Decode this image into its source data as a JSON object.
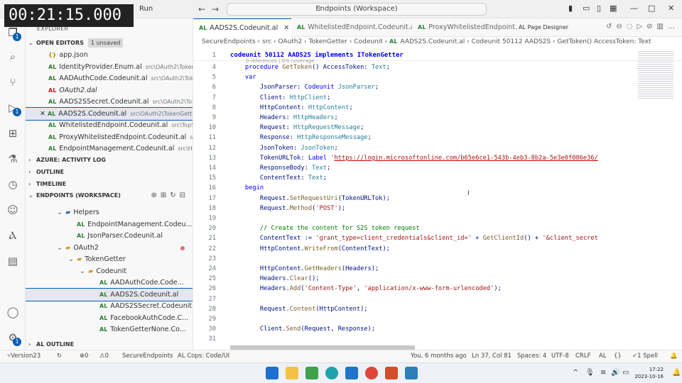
{
  "timer": "00:21:15.000",
  "menu": {
    "run": "Run"
  },
  "command_center": {
    "text": "Endpoints (Workspace)"
  },
  "explorer": {
    "title": "EXPLORER",
    "open_editors_label": "OPEN EDITORS",
    "unsaved_badge": "1 unsaved",
    "open_editors": [
      {
        "icon": "json",
        "name": "app.json",
        "path": "",
        "style": "normal"
      },
      {
        "icon": "AL",
        "name": "IdentityProvider.Enum.al",
        "path": "src\\OAuth2\\Token...",
        "style": "normal"
      },
      {
        "icon": "AL",
        "name": "AADAuthCode.Codeunit.al",
        "path": "src\\OAuth2\\Tok...",
        "style": "normal"
      },
      {
        "icon": "AL",
        "name": "OAuth2.dal",
        "path": "",
        "style": "italic"
      },
      {
        "icon": "AL",
        "name": "AADS2SSecret.Codeunit.al",
        "path": "src\\OAuth2\\Tok...",
        "style": "normal"
      },
      {
        "icon": "AL",
        "name": "AADS2S.Codeunit.al",
        "path": "src\\OAuth2\\TokenGett...",
        "style": "selected"
      },
      {
        "icon": "AL",
        "name": "WhitelistedEndpoint.Codeunit.al",
        "path": "src\\TopSe...",
        "style": "normal"
      },
      {
        "icon": "AL",
        "name": "ProxyWhitelistedEndpoint.Codeunit.al",
        "path": "src\\...",
        "style": "normal"
      },
      {
        "icon": "AL",
        "name": "EndpointManagement.Codeunit.al",
        "path": "src\\Hel...",
        "style": "normal"
      }
    ],
    "azure_label": "AZURE: ACTIVITY LOG",
    "outline_label": "OUTLINE",
    "timeline_label": "TIMELINE",
    "workspace_label": "ENDPOINTS (WORKSPACE)",
    "tree": [
      {
        "type": "folder",
        "name": "Helpers",
        "indent": 3
      },
      {
        "type": "file",
        "name": "EndpointManagement.Codeu...",
        "indent": 4
      },
      {
        "type": "file",
        "name": "JsonParser.Codeunit.al",
        "indent": 4
      },
      {
        "type": "folder",
        "name": "OAuth2",
        "indent": 3
      },
      {
        "type": "folder",
        "name": "TokenGetter",
        "indent": 4
      },
      {
        "type": "folder",
        "name": "Codeunit",
        "indent": 5
      },
      {
        "type": "file",
        "name": "AADAuthCode.Code...",
        "indent": 6
      },
      {
        "type": "file",
        "name": "AADS2S.Codeunit.al",
        "indent": 6
      },
      {
        "type": "file",
        "name": "AADS2SSecret.Codeunit.al",
        "indent": 6
      },
      {
        "type": "file",
        "name": "FacebookAuthCode.C...",
        "indent": 6
      },
      {
        "type": "file",
        "name": "TokenGetterNone.Co...",
        "indent": 6
      }
    ],
    "al_outline_label": "AL OUTLINE"
  },
  "tabs": [
    {
      "label": "AADS2S.Codeunit.al",
      "active": true
    },
    {
      "label": "WhitelistedEndpoint.Codeunit.al",
      "active": false
    },
    {
      "label": "ProxyWhitelistedEndpoint.Code",
      "active": false
    }
  ],
  "tab_designer": "AL Page Designer",
  "breadcrumb": [
    "SecureEndpoints",
    "src",
    "OAuth2",
    "TokenGetter",
    "Codeunit",
    "AADS2S.Codeunit.al",
    "Codeunit 50112 AADS2S",
    "GetToken() AccessToken: Text"
  ],
  "sticky": {
    "num": "1",
    "text": "codeunit 50112 AADS2S implements ITokenGetter"
  },
  "codelens": "0 references | 0% coverage",
  "code_lines": [
    {
      "n": "4",
      "t": "    procedure GetToken() AccessToken: Text;"
    },
    {
      "n": "5",
      "t": "    var"
    },
    {
      "n": "6",
      "t": "        JsonParser: Codeunit JsonParser;"
    },
    {
      "n": "7",
      "t": "        Client: HttpClient;"
    },
    {
      "n": "8",
      "t": "        HttpContent: HttpContent;"
    },
    {
      "n": "9",
      "t": "        Headers: HttpHeaders;"
    },
    {
      "n": "10",
      "t": "        Request: HttpRequestMessage;"
    },
    {
      "n": "11",
      "t": "        Response: HttpResponseMessage;"
    },
    {
      "n": "12",
      "t": "        JsonToken: JsonToken;"
    },
    {
      "n": "13",
      "t": "        TokenURLTok: Label 'https://login.microsoftonline.com/b65e6ce1-543b-4eb3-8b2a-5e3e0f086e36/"
    },
    {
      "n": "14",
      "t": "        ResponseBody: Text;"
    },
    {
      "n": "15",
      "t": "        ContentText: Text;"
    },
    {
      "n": "16",
      "t": "    begin"
    },
    {
      "n": "17",
      "t": "        Request.SetRequestUri(TokenURLTok);"
    },
    {
      "n": "18",
      "t": "        Request.Method('POST');"
    },
    {
      "n": "19",
      "t": ""
    },
    {
      "n": "20",
      "t": "        // Create the content for S2S token request"
    },
    {
      "n": "21",
      "t": "        ContentText := 'grant_type=client_credentials&client_id=' + GetClientId() + '&client_secret"
    },
    {
      "n": "22",
      "t": "        HttpContent.WriteFrom(ContentText);"
    },
    {
      "n": "23",
      "t": ""
    },
    {
      "n": "24",
      "t": "        HttpContent.GetHeaders(Headers);"
    },
    {
      "n": "25",
      "t": "        Headers.Clear();"
    },
    {
      "n": "26",
      "t": "        Headers.Add('Content-Type', 'application/x-www-form-urlencoded');"
    },
    {
      "n": "27",
      "t": ""
    },
    {
      "n": "28",
      "t": "        Request.Content(HttpContent);"
    },
    {
      "n": "29",
      "t": ""
    },
    {
      "n": "30",
      "t": "        Client.Send(Request, Response);"
    },
    {
      "n": "31",
      "t": ""
    }
  ],
  "status": {
    "branch": "Version23",
    "sync": "0",
    "errors": "0",
    "warnings": "0",
    "project": "SecureEndpoints",
    "cops": "AL Cops: Code/UI",
    "blame": "You, 6 months ago",
    "position": "Ln 37, Col 81",
    "spaces": "Spaces: 4",
    "encoding": "UTF-8",
    "eol": "CRLF",
    "lang": "AL",
    "spell": "1 Spell"
  },
  "taskbar": {
    "time": "17:22",
    "date": "2023-10-16"
  },
  "colors": {
    "accent": "#005fb8",
    "keyword": "#0000ff",
    "type": "#267f99",
    "string": "#a31515",
    "comment": "#008000"
  }
}
